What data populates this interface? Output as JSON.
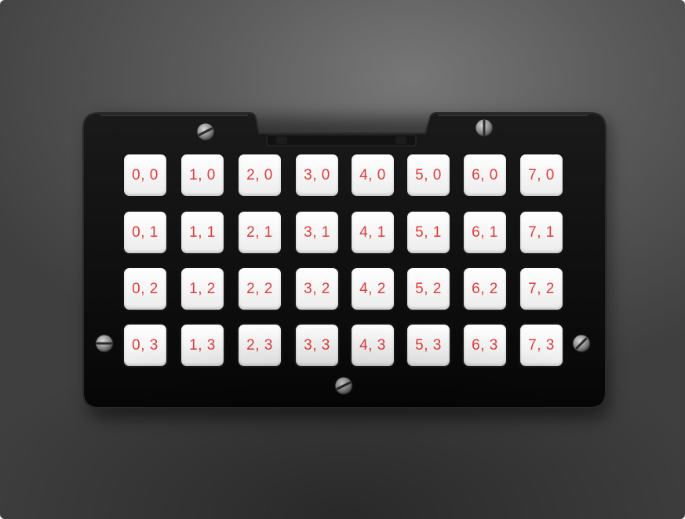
{
  "keypad": {
    "keys": [
      [
        "0, 0",
        "1, 0",
        "2, 0",
        "3, 0",
        "4, 0",
        "5, 0",
        "6, 0",
        "7, 0"
      ],
      [
        "0, 1",
        "1, 1",
        "2, 1",
        "3, 1",
        "4, 1",
        "5, 1",
        "6, 1",
        "7, 1"
      ],
      [
        "0, 2",
        "1, 2",
        "2, 2",
        "3, 2",
        "4, 2",
        "5, 2",
        "6, 2",
        "7, 2"
      ],
      [
        "0, 3",
        "1, 3",
        "2, 3",
        "3, 3",
        "4, 3",
        "5, 3",
        "6, 3",
        "7, 3"
      ]
    ],
    "label_color": "#e23a3a",
    "key_color": "#f4f4f4",
    "board_color": "#0b0b0b"
  }
}
